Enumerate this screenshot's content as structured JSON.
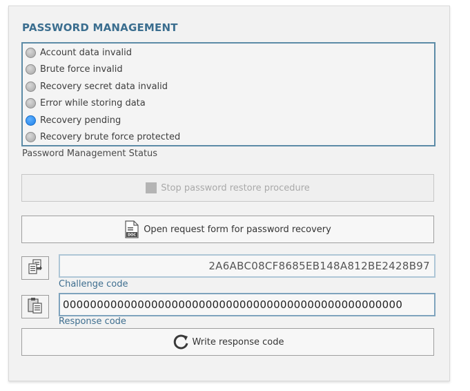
{
  "panel": {
    "title": "PASSWORD MANAGEMENT",
    "status_items": [
      {
        "label": "Account data invalid",
        "active": false
      },
      {
        "label": "Brute force invalid",
        "active": false
      },
      {
        "label": "Recovery secret data invalid",
        "active": false
      },
      {
        "label": "Error while storing data",
        "active": false
      },
      {
        "label": "Recovery pending",
        "active": true
      },
      {
        "label": "Recovery brute force protected",
        "active": false
      }
    ],
    "status_caption": "Password Management Status",
    "stop_button": {
      "label": "Stop password restore procedure",
      "enabled": false,
      "icon": "stop-icon"
    },
    "open_form_button": {
      "label": "Open request form for password recovery",
      "icon": "doc-icon"
    },
    "challenge": {
      "value": "2A6ABC08CF8685EB148A812BE2428B97",
      "label": "Challenge code",
      "icon": "copy-icon"
    },
    "response": {
      "value": "00000000000000000000000000000000000000000000000000",
      "label": "Response code",
      "icon": "paste-icon"
    },
    "write_button": {
      "label": "Write response code",
      "icon": "refresh-icon"
    }
  },
  "colors": {
    "accent": "#3b6e8f",
    "led_active": "#1f80e8",
    "led_inactive": "#a5a5a5"
  }
}
